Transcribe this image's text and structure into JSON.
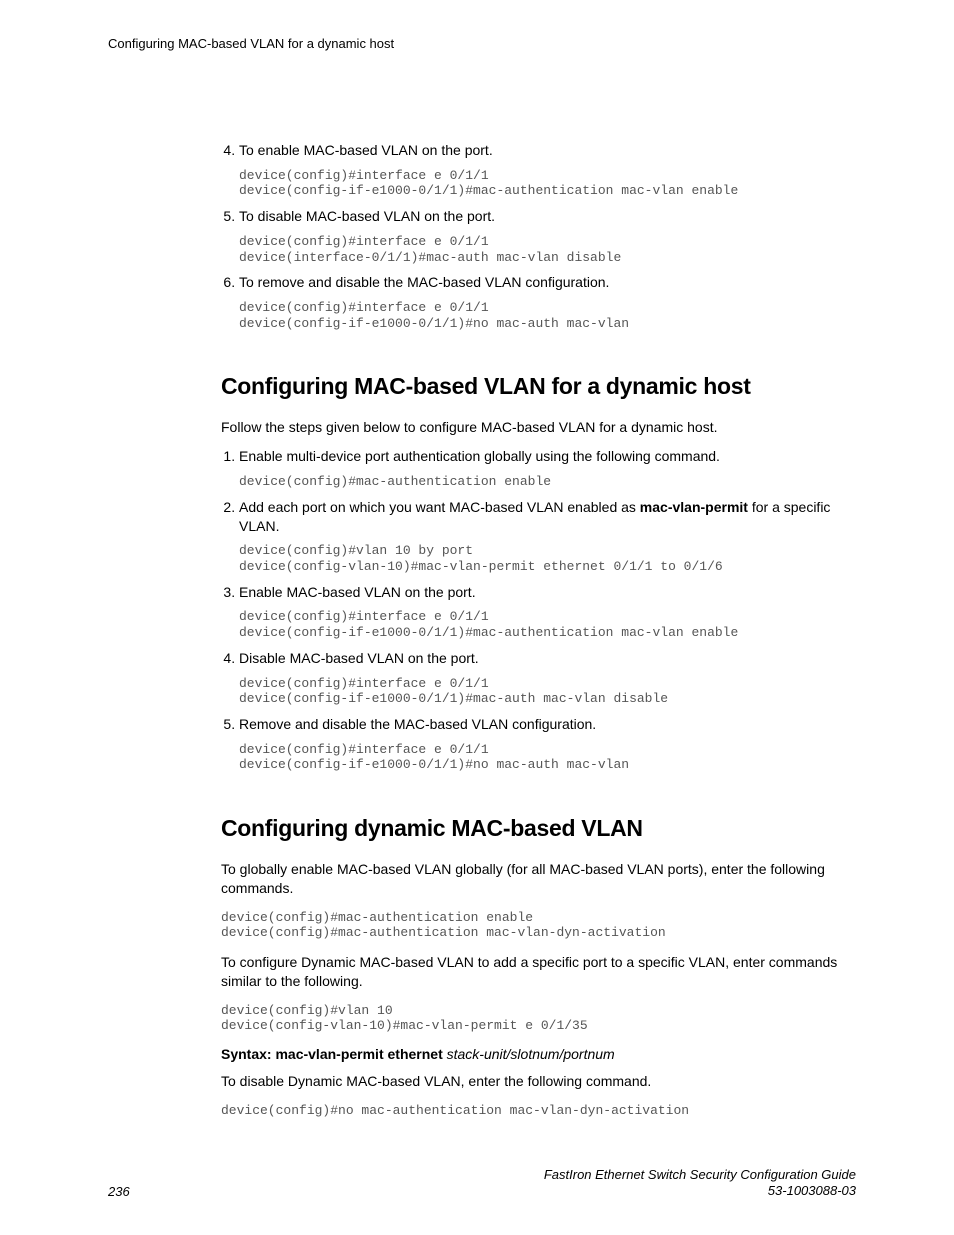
{
  "running_head": "Configuring MAC-based VLAN for a dynamic host",
  "section1": {
    "steps": [
      {
        "num": "4",
        "text": "To enable MAC-based VLAN on the port.",
        "code": "device(config)#interface e 0/1/1\ndevice(config-if-e1000-0/1/1)#mac-authentication mac-vlan enable"
      },
      {
        "num": "5",
        "text": "To disable MAC-based VLAN on the port.",
        "code": "device(config)#interface e 0/1/1\ndevice(interface-0/1/1)#mac-auth mac-vlan disable"
      },
      {
        "num": "6",
        "text": "To remove and disable the MAC-based VLAN configuration.",
        "code": "device(config)#interface e 0/1/1\ndevice(config-if-e1000-0/1/1)#no mac-auth mac-vlan"
      }
    ]
  },
  "section2": {
    "title": "Configuring MAC-based VLAN for a dynamic host",
    "intro": "Follow the steps given below to configure MAC-based VLAN for a dynamic host.",
    "steps": [
      {
        "num": "1",
        "text": "Enable multi-device port authentication globally using the following command.",
        "code": "device(config)#mac-authentication enable"
      },
      {
        "num": "2",
        "text_pre": "Add each port on which you want MAC-based VLAN enabled as ",
        "bold": "mac-vlan-permit",
        "text_post": " for a specific VLAN.",
        "code": "device(config)#vlan 10 by port\ndevice(config-vlan-10)#mac-vlan-permit ethernet 0/1/1 to 0/1/6"
      },
      {
        "num": "3",
        "text": "Enable MAC-based VLAN on the port.",
        "code": "device(config)#interface e 0/1/1\ndevice(config-if-e1000-0/1/1)#mac-authentication mac-vlan enable"
      },
      {
        "num": "4",
        "text": "Disable MAC-based VLAN on the port.",
        "code": "device(config)#interface e 0/1/1\ndevice(config-if-e1000-0/1/1)#mac-auth mac-vlan disable"
      },
      {
        "num": "5",
        "text": "Remove and disable the MAC-based VLAN configuration.",
        "code": "device(config)#interface e 0/1/1\ndevice(config-if-e1000-0/1/1)#no mac-auth mac-vlan"
      }
    ]
  },
  "section3": {
    "title": "Configuring dynamic MAC-based VLAN",
    "para1": "To globally enable MAC-based VLAN globally (for all MAC-based VLAN ports), enter the following commands.",
    "code1": "device(config)#mac-authentication enable\ndevice(config)#mac-authentication mac-vlan-dyn-activation",
    "para2": "To configure Dynamic MAC-based VLAN to add a specific port to a specific VLAN, enter commands similar to the following.",
    "code2": "device(config)#vlan 10\ndevice(config-vlan-10)#mac-vlan-permit e 0/1/35",
    "syntax_bold": "Syntax: mac-vlan-permit ethernet",
    "syntax_ital": " stack-unit/slotnum/portnum",
    "para3": "To disable Dynamic MAC-based VLAN, enter the following command.",
    "code3": "device(config)#no mac-authentication mac-vlan-dyn-activation"
  },
  "footer": {
    "page": "236",
    "title": "FastIron Ethernet Switch Security Configuration Guide",
    "docnum": "53-1003088-03"
  }
}
